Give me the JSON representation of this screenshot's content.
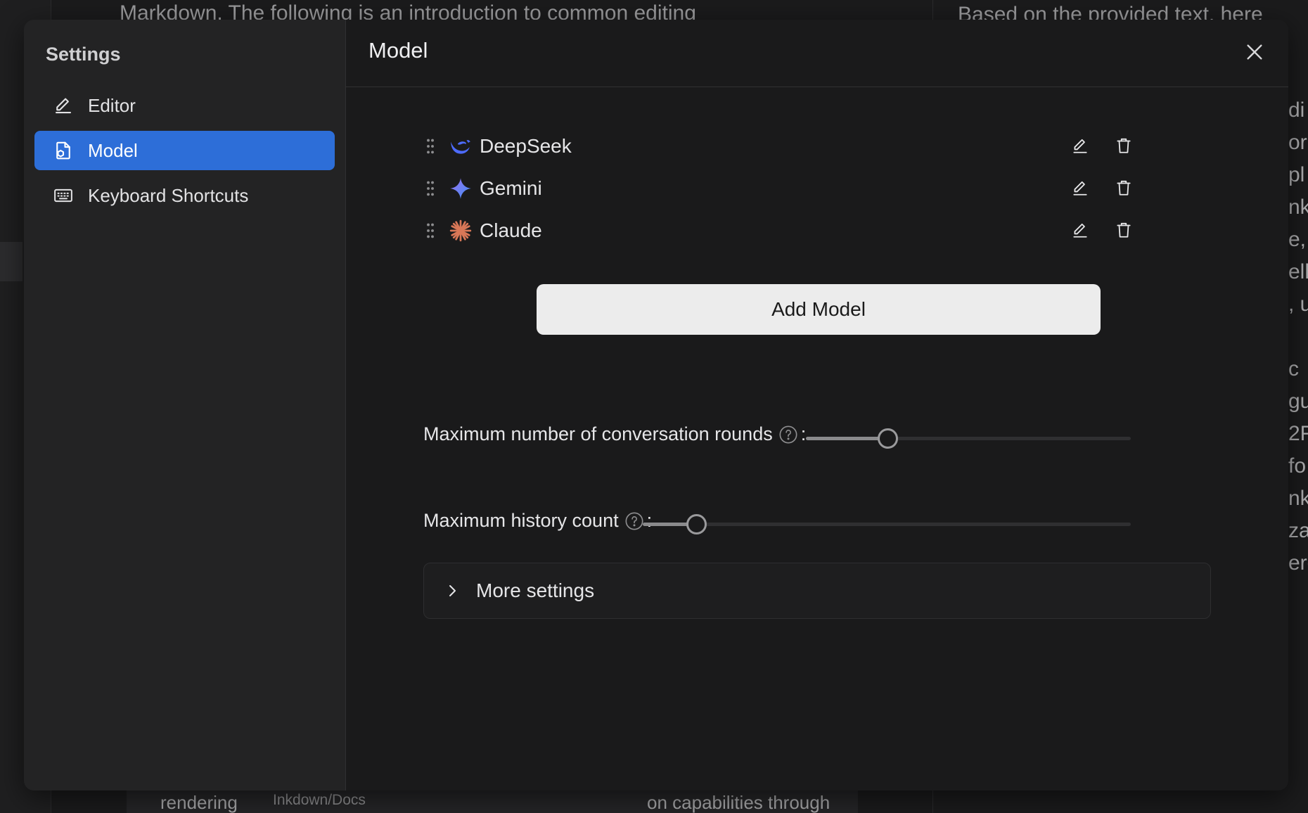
{
  "background": {
    "top_text": "Markdown. The following is an introduction to common editing",
    "right_top_text": "Based on the provided text, here",
    "right_column": [
      "di",
      "or",
      "pl",
      "nk",
      "e, ",
      "ells",
      ", u",
      "",
      "c",
      "gu",
      "2F",
      "fo",
      "nk",
      "zat",
      "ere"
    ],
    "bottom_left": "rendering",
    "bottom_path": "Inkdown/Docs",
    "bottom_right": "on capabilities through"
  },
  "sidebar": {
    "title": "Settings",
    "items": [
      {
        "label": "Editor",
        "icon": "pen-icon",
        "active": false
      },
      {
        "label": "Model",
        "icon": "model-icon",
        "active": true
      },
      {
        "label": "Keyboard Shortcuts",
        "icon": "keyboard-icon",
        "active": false
      }
    ]
  },
  "main": {
    "title": "Model",
    "models": [
      {
        "name": "DeepSeek",
        "icon": "deepseek-logo-icon",
        "color": "#4d6bfe"
      },
      {
        "name": "Gemini",
        "icon": "gemini-logo-icon",
        "color": "#4f8df5"
      },
      {
        "name": "Claude",
        "icon": "claude-logo-icon",
        "color": "#d97757"
      }
    ],
    "add_model_label": "Add Model",
    "settings": [
      {
        "label": "Maximum number of conversation rounds",
        "colon": ":",
        "slider_fraction": 0.25
      },
      {
        "label": "Maximum history count",
        "colon": ":",
        "slider_fraction": 0.11
      }
    ],
    "more_settings_label": "More settings"
  },
  "colors": {
    "accent": "#2d6ed8",
    "background": "#1a1a1b",
    "sidebar": "#232324"
  }
}
